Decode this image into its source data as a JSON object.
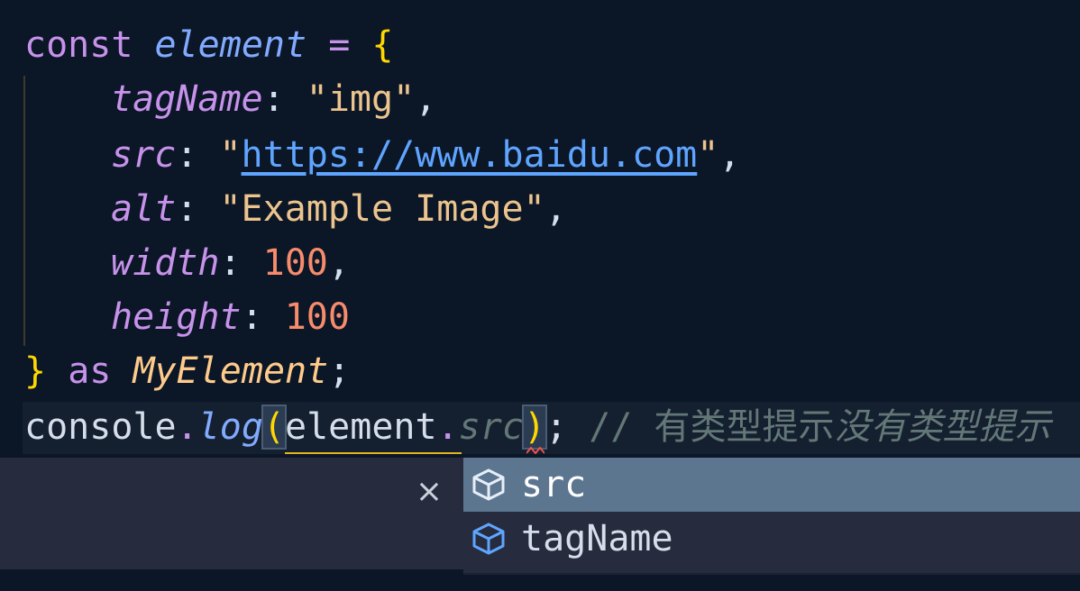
{
  "code": {
    "line1": {
      "kw": "const",
      "name": "element",
      "op": "=",
      "brace": "{"
    },
    "line2": {
      "key": "tagName",
      "colon": ":",
      "value": "\"img\"",
      "comma": ","
    },
    "line3": {
      "key": "src",
      "colon": ":",
      "q1": "\"",
      "url": "https://www.baidu.com",
      "q2": "\"",
      "comma": ","
    },
    "line4": {
      "key": "alt",
      "colon": ":",
      "value": "\"Example Image\"",
      "comma": ","
    },
    "line5": {
      "key": "width",
      "colon": ":",
      "value": "100",
      "comma": ","
    },
    "line6": {
      "key": "height",
      "colon": ":",
      "value": "100"
    },
    "line7": {
      "brace": "}",
      "kw": "as",
      "type": "MyElement",
      "semi": ";"
    },
    "line8": {
      "obj": "console",
      "dot": ".",
      "method": "log",
      "paren_open": "(",
      "arg": "element",
      "arg_dot": ".",
      "ghost": "src",
      "paren_close": ")",
      "semi": ";",
      "comment": "// 有类型提示",
      "comment_italic": "没有类型提示"
    }
  },
  "suggest": {
    "close_glyph": "×",
    "items": [
      {
        "label": "src",
        "icon": "property-cube-icon",
        "selected": true
      },
      {
        "label": "tagName",
        "icon": "property-cube-icon",
        "selected": false
      }
    ]
  },
  "colors": {
    "background": "#0b1627",
    "keyword": "#c792ea",
    "string": "#ecc48d",
    "number": "#f78c6c",
    "url": "#5fa5ff",
    "selected_suggestion": "#5d7690"
  }
}
